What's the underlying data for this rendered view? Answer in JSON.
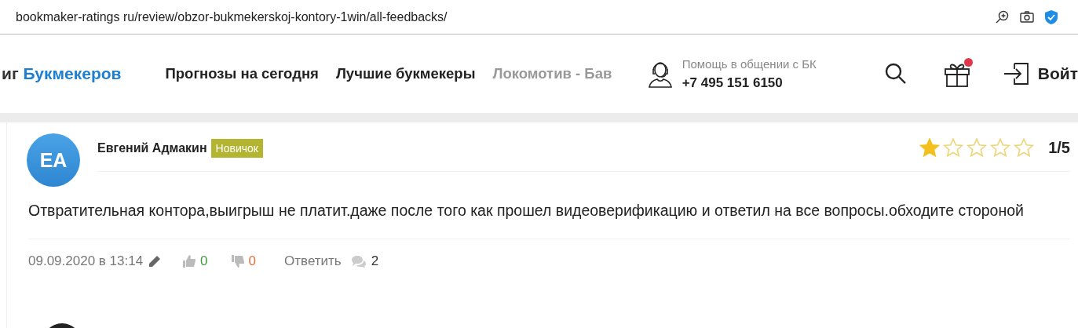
{
  "address_bar": {
    "url": "bookmaker-ratings ru/review/obzor-bukmekerskoj-kontory-1win/all-feedbacks/"
  },
  "header": {
    "logo": {
      "prefix": "иг",
      "name": "Букмекеров"
    },
    "nav": [
      {
        "label": "Прогнозы на сегодня",
        "faded": false
      },
      {
        "label": "Лучшие букмекеры",
        "faded": false
      },
      {
        "label": "Локомотив - Бав",
        "faded": true
      }
    ],
    "support": {
      "caption": "Помощь в общении с БК",
      "phone": "+7 495 151 6150"
    },
    "gift_notification": true,
    "login": "Войт"
  },
  "review": {
    "author": {
      "initials": "EA",
      "name": "Евгений Адмакин",
      "badge": "Новичок"
    },
    "stars": 1,
    "score": "1/5",
    "text": "Отвратительная контора,выигрыш не платит.даже после того как прошел видеоверификацию и ответил на все вопросы.обходите стороной",
    "date": "09.09.2020 в 13:14",
    "likes": "0",
    "dislikes": "0",
    "reply": "Ответить",
    "comments": "2"
  }
}
